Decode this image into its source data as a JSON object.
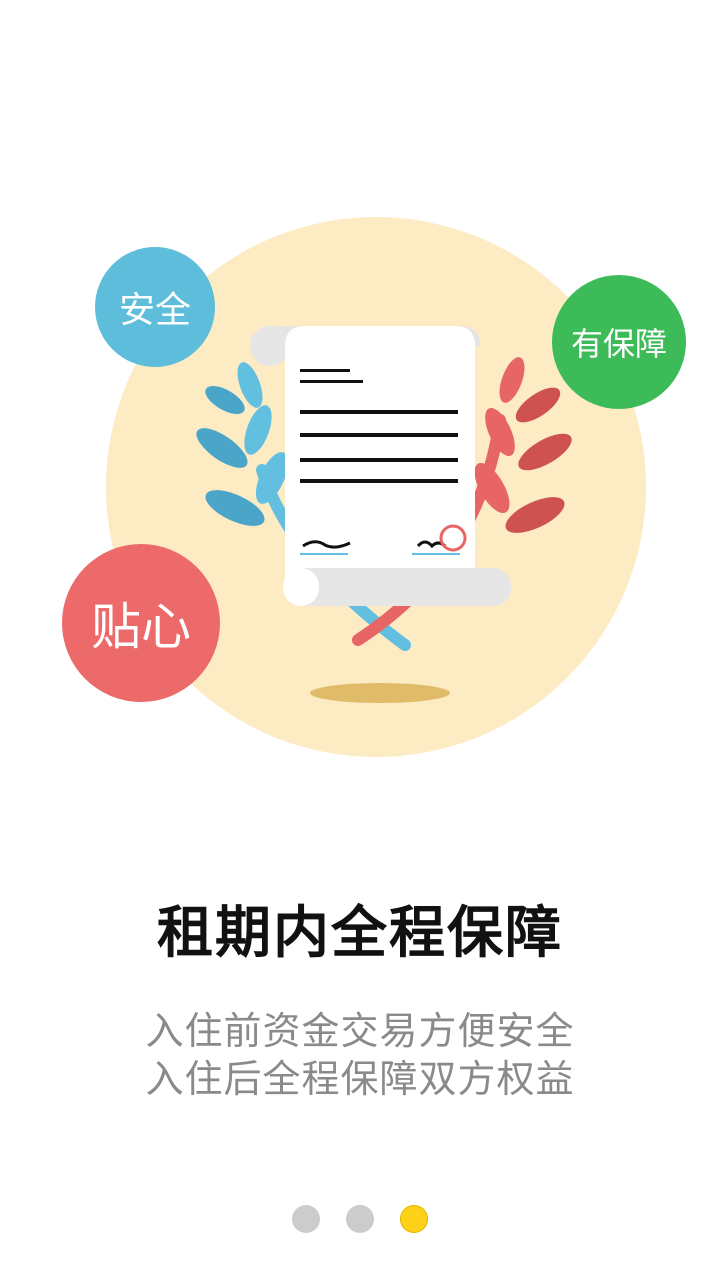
{
  "colors": {
    "background": "#ffffff",
    "circle": "#fdebc4",
    "bubble_safe": "#5dbdda",
    "bubble_guarantee": "#3dbb58",
    "bubble_caring": "#ec6a6a",
    "dot_inactive": "#cccccc",
    "dot_active": "#fdd118"
  },
  "illustration": {
    "badge_safe": "安全",
    "badge_guarantee": "有保障",
    "badge_caring": "贴心",
    "icon": "contract-scroll-icon"
  },
  "headline": "租期内全程保障",
  "description": {
    "line1": "入住前资金交易方便安全",
    "line2": "入住后全程保障双方权益"
  },
  "pager": {
    "total_pages": 3,
    "active_page": 3
  }
}
